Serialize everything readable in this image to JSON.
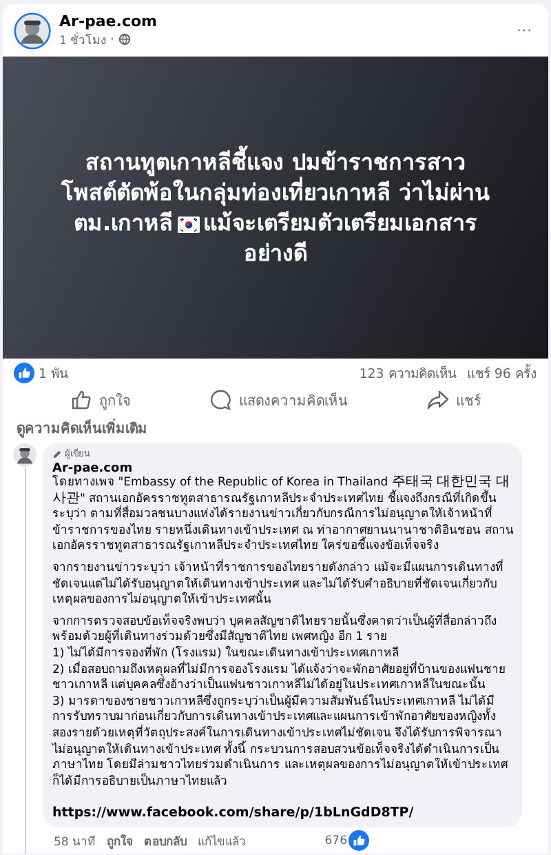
{
  "post": {
    "author": "Ar-pae.com",
    "time": "1 ชั่วโมง",
    "separator": "·",
    "menu": "···",
    "title_before": "สถานทูตเกาหลีชี้แจง ปมข้าราชการสาวโพสต์ตัดพ้อในกลุ่มท่องเที่ยวเกาหลี ว่าไม่ผ่าน ตม.เกาหลี",
    "title_after": "แม้จะเตรียมตัวเตรียมเอกสารอย่างดี"
  },
  "stats": {
    "reactions": "1 พัน",
    "comments": "123 ความคิดเห็น",
    "shares": "แชร์ 96 ครั้ง"
  },
  "actions": [
    {
      "kind": "like",
      "label": "ถูกใจ"
    },
    {
      "kind": "comment",
      "label": "แสดงความคิดเห็น"
    },
    {
      "kind": "share",
      "label": "แชร์"
    }
  ],
  "more_comments": "ดูความคิดเห็นเพิ่มเติม",
  "comment": {
    "badge": "ผู้เขียน",
    "author": "Ar-pae.com",
    "paragraphs": [
      "โดยทางเพจ \"Embassy of the Republic of Korea in Thailand 주태국 대한민국 대사관\" สถานเอกอัครราชทูตสาธารณรัฐเกาหลีประจำประเทศไทย ชี้แจงถึงกรณีที่เกิดขึ้น ระบุว่า ตามที่สื่อมวลชนบางแห่งได้รายงานข่าวเกี่ยวกับกรณีการไม่อนุญาตให้เจ้าหน้าที่ข้าราชการของไทย รายหนึ่งเดินทางเข้าประเทศ ณ ท่าอากาศยานนานาชาติอินชอน สถานเอกอัครราชทูตสาธารณรัฐเกาหลีประจำประเทศไทย ใคร่ขอชี้แจงข้อเท็จจริง",
      "จากรายงานข่าวระบุว่า เจ้าหน้าที่ราชการของไทยรายดังกล่าว แม้จะมีแผนการเดินทางที่ชัดเจนแต่ไม่ได้รับอนุญาตให้เดินทางเข้าประเทศ และไม่ได้รับคำอธิบายที่ชัดเจนเกี่ยวกับเหตุผลของการไม่อนุญาตให้เข้าประเทศนั้น",
      "จากการตรวจสอบข้อเท็จจริงพบว่า บุคคลสัญชาติไทยรายนั้นซึ่งคาดว่าเป็นผู้ที่สื่อกล่าวถึงพร้อมด้วยผู้ที่เดินทางร่วมด้วยซึ่งมีสัญชาติไทย เพศหญิง อีก 1 ราย\n1) ไม่ได้มีการจองที่พัก (โรงแรม) ในขณะเดินทางเข้าประเทศเกาหลี\n2) เมื่อสอบถามถึงเหตุผลที่ไม่มีการจองโรงแรม ได้แจ้งว่าจะพักอาศัยอยู่ที่บ้านของแฟนชายชาวเกาหลี แต่บุคคลซึ่งอ้างว่าเป็นแฟนชาวเกาหลีไม่ได้อยู่ในประเทศเกาหลีในขณะนั้น\n3) มารดาของชายชาวเกาหลีซึ่งถูกระบุว่าเป็นผู้มีความสัมพันธ์ในประเทศเกาหลี ไม่ได้มีการรับทราบมาก่อนเกี่ยวกับการเดินทางเข้าประเทศและแผนการเข้าพักอาศัยของหญิงทั้งสองรายด้วยเหตุที่วัตถุประสงค์ในการเดินทางเข้าประเทศไม่ชัดเจน จึงได้รับการพิจารณาไม่อนุญาตให้เดินทางเข้าประเทศ ทั้งนี้ กระบวนการสอบสวนข้อเท็จจริงได้ดำเนินการเป็นภาษาไทย โดยมีล่ามชาวไทยร่วมดำเนินการ และเหตุผลของการไม่อนุญาตให้เข้าประเทศก็ได้มีการอธิบายเป็นภาษาไทยแล้ว"
    ],
    "link": "https://www.facebook.com/share/p/1bLnGdD8TP/",
    "time": "58 นาที",
    "like": "ถูกใจ",
    "reply": "ตอบกลับ",
    "edited": "แก้ไขแล้ว",
    "reaction_count": "676"
  }
}
